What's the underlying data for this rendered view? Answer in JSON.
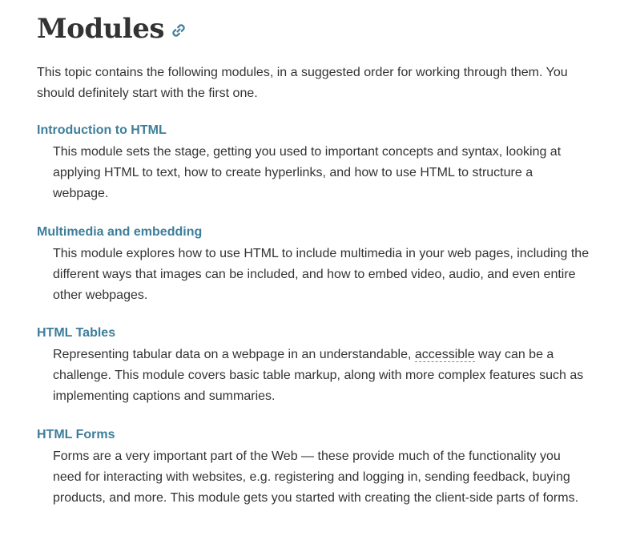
{
  "heading": "Modules",
  "intro": "This topic contains the following modules, in a suggested order for working through them. You should definitely start with the first one.",
  "modules": [
    {
      "title": "Introduction to HTML",
      "description": "This module sets the stage, getting you used to important concepts and syntax, looking at applying HTML to text, how to create hyperlinks, and how to use HTML to structure a webpage."
    },
    {
      "title": "Multimedia and embedding",
      "description": "This module explores how to use HTML to include multimedia in your web pages, including the different ways that images can be included, and how to embed video, audio, and even entire other webpages."
    },
    {
      "title": "HTML Tables",
      "description_before": "Representing tabular data on a webpage in an understandable, ",
      "description_abbr": "accessible",
      "description_after": " way can be a challenge. This module covers basic table markup, along with more complex features such as implementing captions and summaries."
    },
    {
      "title": "HTML Forms",
      "description": "Forms are a very important part of the Web — these provide much of the functionality you need for interacting with websites, e.g. registering and logging in, sending feedback, buying products, and more. This module gets you started with creating the client-side parts of forms."
    }
  ],
  "colors": {
    "link": "#3d7e9a",
    "text": "#333333",
    "heading": "#333333"
  },
  "icons": {
    "anchor": "link-icon"
  }
}
